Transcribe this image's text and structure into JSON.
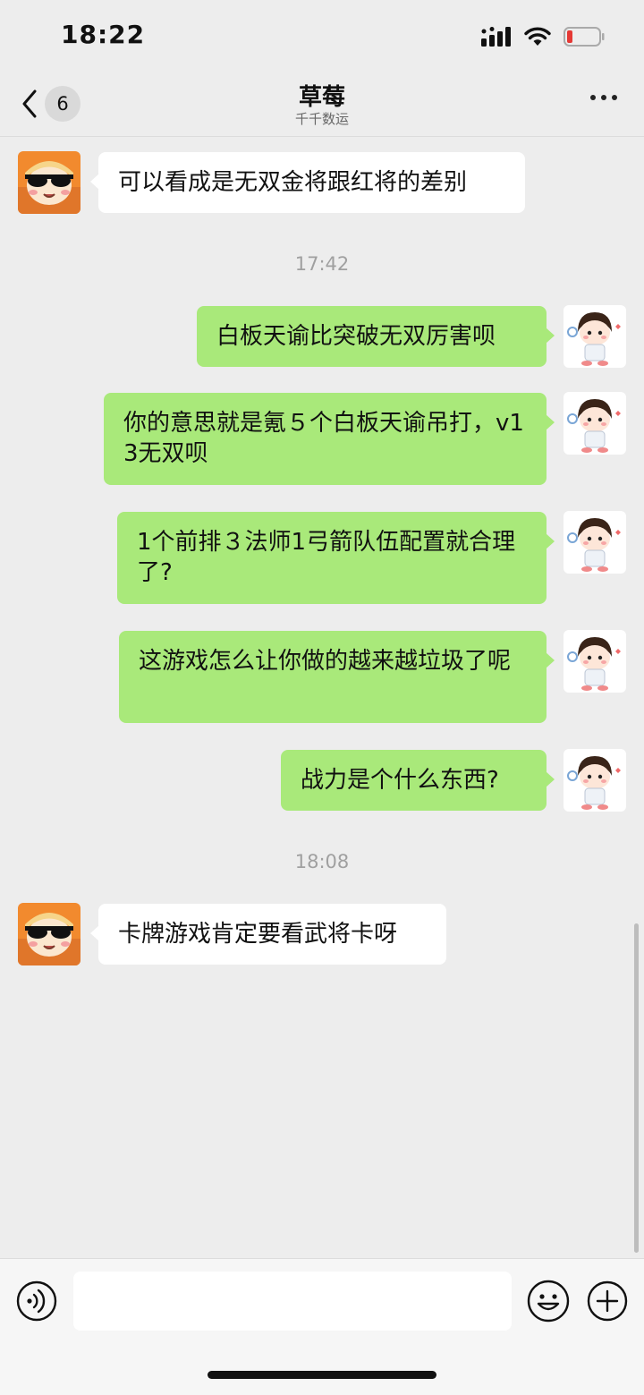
{
  "status_bar": {
    "time": "18:22"
  },
  "header": {
    "back_count": "6",
    "title": "草莓",
    "subtitle": "千千数运"
  },
  "messages": [
    {
      "side": "in",
      "text": "可以看成是无双金将跟红将的差别"
    },
    {
      "type": "timestamp",
      "text": "17:42"
    },
    {
      "side": "out",
      "text": "白板天谕比突破无双厉害呗"
    },
    {
      "side": "out",
      "text": "你的意思就是氪５个白板天谕吊打，v13无双呗"
    },
    {
      "side": "out",
      "text": "1个前排３法师1弓箭队伍配置就合理了?"
    },
    {
      "side": "out",
      "text": "这游戏怎么让你做的越来越垃圾了呢"
    },
    {
      "side": "out",
      "text": "战力是个什么东西?"
    },
    {
      "type": "timestamp",
      "text": "18:08"
    },
    {
      "side": "in",
      "text": "卡牌游戏肯定要看武将卡呀"
    }
  ],
  "input": {
    "value": ""
  },
  "colors": {
    "outgoing_bubble": "#a9e97a",
    "incoming_bubble": "#ffffff",
    "background": "#ededed"
  },
  "icons": [
    "back-chevron-icon",
    "more-icon",
    "voice-icon",
    "emoji-icon",
    "plus-icon",
    "signal-icon",
    "wifi-icon",
    "battery-icon"
  ]
}
